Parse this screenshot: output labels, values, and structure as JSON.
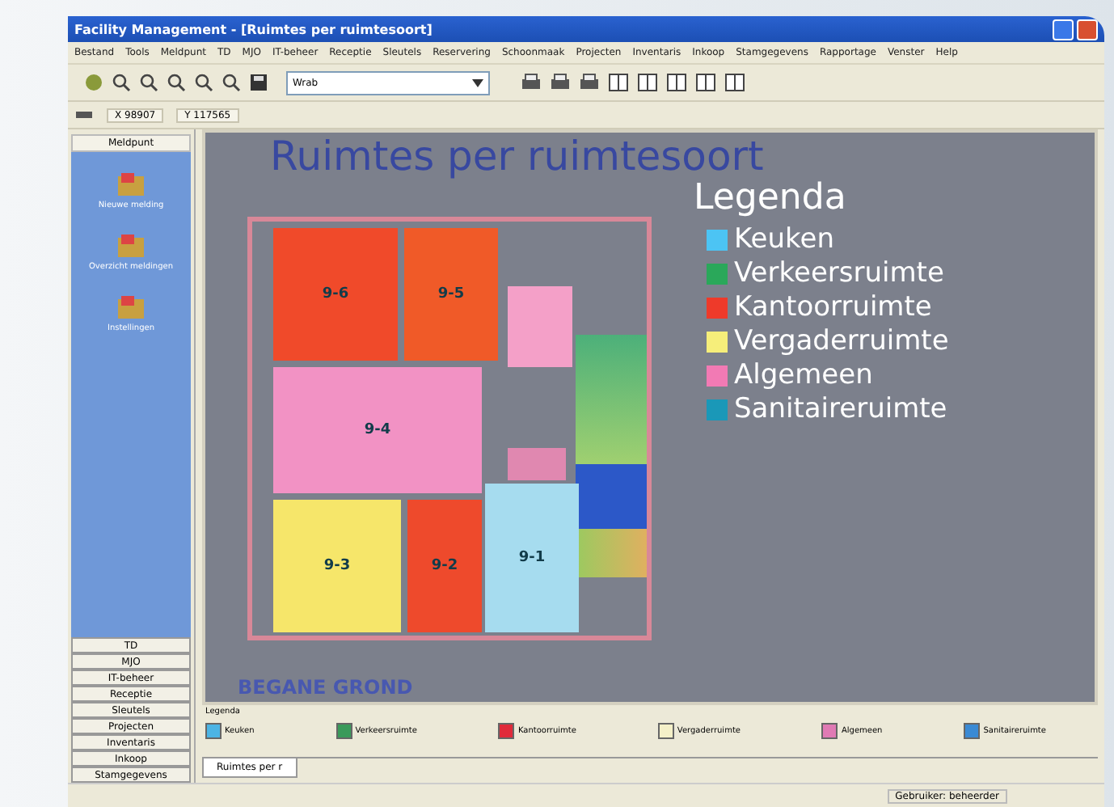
{
  "window": {
    "title": "Facility Management - [Ruimtes per ruimtesoort]"
  },
  "menu": [
    "Bestand",
    "Tools",
    "Meldpunt",
    "TD",
    "MJO",
    "IT-beheer",
    "Receptie",
    "Sleutels",
    "Reservering",
    "Schoonmaak",
    "Projecten",
    "Inventaris",
    "Inkoop",
    "Stamgegevens",
    "Rapportage",
    "Venster",
    "Help"
  ],
  "toolbar": {
    "layer_select": "Wrab"
  },
  "coords": {
    "x": "X 98907",
    "y": "Y 117565"
  },
  "sidebar": {
    "header": "Meldpunt",
    "items": [
      {
        "label": "Nieuwe melding"
      },
      {
        "label": "Overzicht meldingen"
      },
      {
        "label": "Instellingen"
      }
    ],
    "modules": [
      "TD",
      "MJO",
      "IT-beheer",
      "Receptie",
      "Sleutels",
      "Projecten",
      "Inventaris",
      "Inkoop",
      "Stamgegevens"
    ]
  },
  "drawing": {
    "title": "Ruimtes per ruimtesoort",
    "floor": "BEGANE GROND",
    "rooms": [
      {
        "label": "9-6",
        "color": "#f04a2a"
      },
      {
        "label": "9-5",
        "color": "#f05a28"
      },
      {
        "label": "9-4",
        "color": "#f292c4"
      },
      {
        "label": "9-3",
        "color": "#f6e66a"
      },
      {
        "label": "9-2",
        "color": "#ee4a2c"
      },
      {
        "label": "9-1",
        "color": "#a6dcef"
      }
    ],
    "legend_title": "Legenda",
    "legend": [
      {
        "label": "Keuken",
        "color": "#4cc4f4"
      },
      {
        "label": "Verkeersruimte",
        "color": "#2aa85a"
      },
      {
        "label": "Kantoorruimte",
        "color": "#ee3a2a"
      },
      {
        "label": "Vergaderruimte",
        "color": "#f6ee7a"
      },
      {
        "label": "Algemeen",
        "color": "#f27ab4"
      },
      {
        "label": "Sanitaireruimte",
        "color": "#1a98b8"
      }
    ]
  },
  "bottom_legend": {
    "title": "Legenda",
    "items": [
      {
        "label": "Keuken",
        "color": "#4cb4e4"
      },
      {
        "label": "Verkeersruimte",
        "color": "#3a9a5a"
      },
      {
        "label": "Kantoorruimte",
        "color": "#e02a3a"
      },
      {
        "label": "Vergaderruimte",
        "color": "#f4f0c8"
      },
      {
        "label": "Algemeen",
        "color": "#e07ab4"
      },
      {
        "label": "Sanitaireruimte",
        "color": "#3a8ad4"
      }
    ]
  },
  "tabs": [
    {
      "label": "Ruimtes per r",
      "selected": true
    }
  ],
  "status_bar": {
    "text": "Gebruiker: beheerder"
  }
}
